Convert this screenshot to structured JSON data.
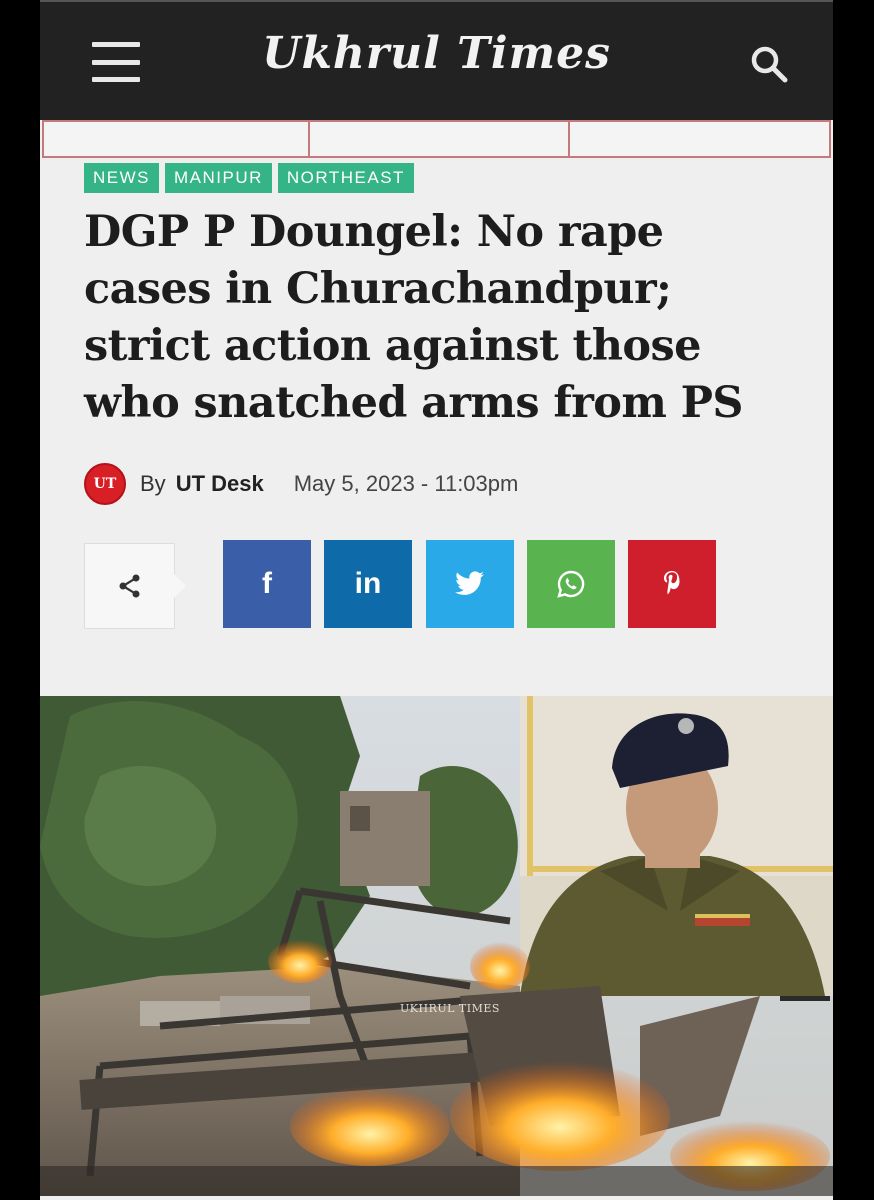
{
  "header": {
    "logo": "Ukhrul Times",
    "menu_icon": "hamburger-menu-icon",
    "search_icon": "search-icon"
  },
  "article": {
    "tags": [
      "NEWS",
      "MANIPUR",
      "NORTHEAST"
    ],
    "headline_lines": [
      "DGP P Doungel: No rape",
      "cases in Churachandpur;",
      "strict action against those",
      "who snatched arms from PS"
    ],
    "byline": {
      "avatar_text": "UT",
      "by": "By",
      "author": "UT Desk",
      "date": "May 5, 2023 - 11:03pm"
    },
    "share": {
      "share_icon": "share-icon",
      "facebook": "f",
      "linkedin": "in",
      "twitter_icon": "twitter-icon",
      "whatsapp_icon": "whatsapp-icon",
      "pinterest_icon": "pinterest-icon"
    },
    "photo": {
      "watermark": "UKHRUL TIMES"
    }
  },
  "colors": {
    "header_bg": "#222222",
    "tag_green": "#35b587",
    "facebook": "#3b5ea8",
    "linkedin": "#0e6aa8",
    "twitter": "#29a9e8",
    "whatsapp": "#59b450",
    "pinterest": "#cf1f2c",
    "avatar_red": "#d81f26"
  }
}
